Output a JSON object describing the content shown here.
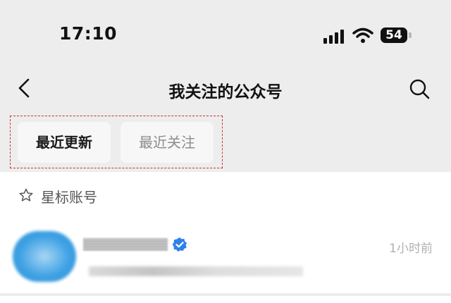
{
  "status_bar": {
    "time": "17:10",
    "battery_level": "54",
    "signal_icon": "cellular-signal-icon",
    "wifi_icon": "wifi-icon"
  },
  "nav": {
    "title": "我关注的公众号",
    "back_icon": "chevron-left-icon",
    "search_icon": "search-icon"
  },
  "tabs": [
    {
      "label": "最近更新",
      "active": true
    },
    {
      "label": "最近关注",
      "active": false
    }
  ],
  "section": {
    "icon": "star-outline-icon",
    "label": "星标账号"
  },
  "accounts": [
    {
      "update_time": "1小时前",
      "verified": true,
      "verified_color": "#2f80ed"
    }
  ],
  "colors": {
    "background": "#ededed",
    "tab_highlight_border": "#c83232",
    "verified_badge": "#2f80ed"
  }
}
